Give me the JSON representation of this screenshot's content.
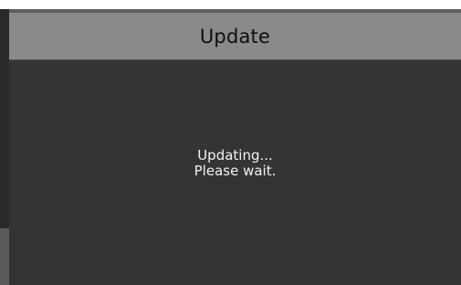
{
  "dialog": {
    "title": "Update",
    "message_line1": "Updating...",
    "message_line2": "Please wait."
  }
}
